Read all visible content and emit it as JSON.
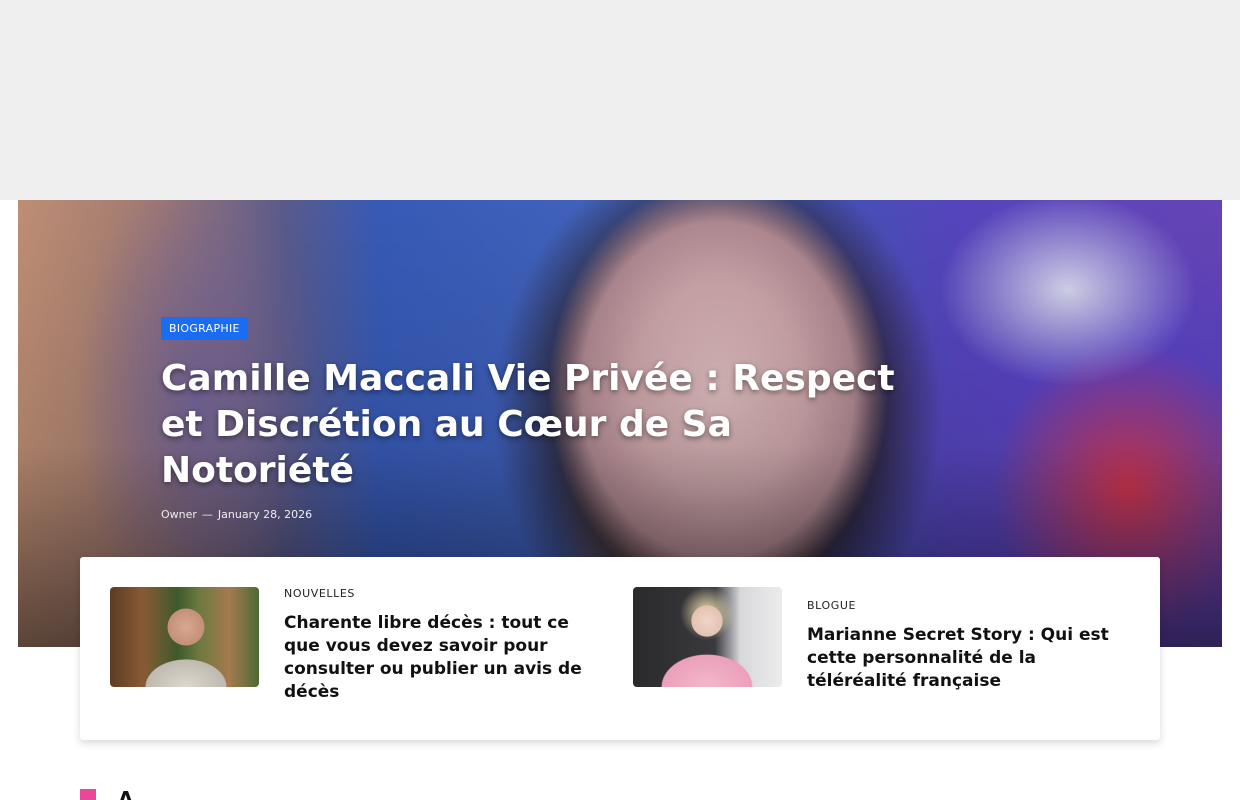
{
  "hero": {
    "category": "BIOGRAPHIE",
    "title": "Camille Maccali Vie Privée : Respect et Discrétion au Cœur de Sa Notoriété",
    "author": "Owner",
    "separator": "—",
    "date": "January 28, 2026",
    "badge_color": "#1a6cf2"
  },
  "cards": [
    {
      "category": "NOUVELLES",
      "title": "Charente libre décès : tout ce que vous devez savoir pour consulter ou publier un avis de décès"
    },
    {
      "category": "BLOGUE",
      "title": "Marianne Secret Story : Qui est cette personnalité de la téléréalité française"
    }
  ],
  "section": {
    "accent_color": "#e8479a",
    "partial_heading": "A"
  }
}
